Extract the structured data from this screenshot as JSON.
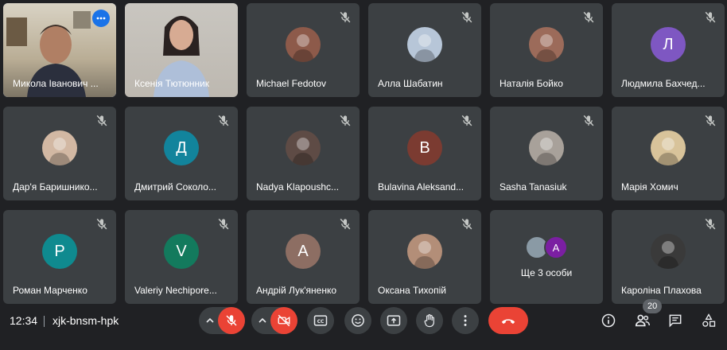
{
  "participants": [
    {
      "name": "Микола Іванович ...",
      "type": "video",
      "active": true
    },
    {
      "name": "Ксенія Тютюнник",
      "type": "video"
    },
    {
      "name": "Michael Fedotov",
      "type": "photo",
      "avatar_color": "#8d5a4a"
    },
    {
      "name": "Алла Шабатин",
      "type": "photo",
      "avatar_color": "#b7c6d8"
    },
    {
      "name": "Наталія Бойко",
      "type": "photo",
      "avatar_color": "#9c6b5a"
    },
    {
      "name": "Людмила Бахчед...",
      "type": "letter",
      "letter": "Л",
      "avatar_color": "#7e57c2"
    },
    {
      "name": "Дар'я Баришнико...",
      "type": "photo",
      "avatar_color": "#d2b8a3"
    },
    {
      "name": "Дмитрий Соколо...",
      "type": "letter",
      "letter": "Д",
      "avatar_color": "#12849c"
    },
    {
      "name": "Nadya Klapoushc...",
      "type": "photo",
      "avatar_color": "#5e4b45"
    },
    {
      "name": "Bulavina Aleksand...",
      "type": "letter",
      "letter": "B",
      "avatar_color": "#7b3b31"
    },
    {
      "name": "Sasha Tanasiuk",
      "type": "photo",
      "avatar_color": "#a8a19a"
    },
    {
      "name": "Марія Хомич",
      "type": "photo",
      "avatar_color": "#d8c39a"
    },
    {
      "name": "Роман Марченко",
      "type": "letter",
      "letter": "Р",
      "avatar_color": "#0f8a8f"
    },
    {
      "name": "Valeriy Nechiporе...",
      "type": "letter",
      "letter": "V",
      "avatar_color": "#137a5d"
    },
    {
      "name": "Андрій Лук'яненко",
      "type": "letter",
      "letter": "A",
      "avatar_color": "#8d6e63"
    },
    {
      "name": "Оксана Тихопій",
      "type": "photo",
      "avatar_color": "#b38e78"
    },
    {
      "name": "Ще 3 особи",
      "type": "group",
      "letter": "A",
      "avatar_color": "#7b1fa2"
    },
    {
      "name": "Кароліна Плахова",
      "type": "photo",
      "avatar_color": "#3a3a3a"
    }
  ],
  "bottom_bar": {
    "time": "12:34",
    "meeting_code": "xjk-bnsm-hpk",
    "participant_count": "20"
  }
}
